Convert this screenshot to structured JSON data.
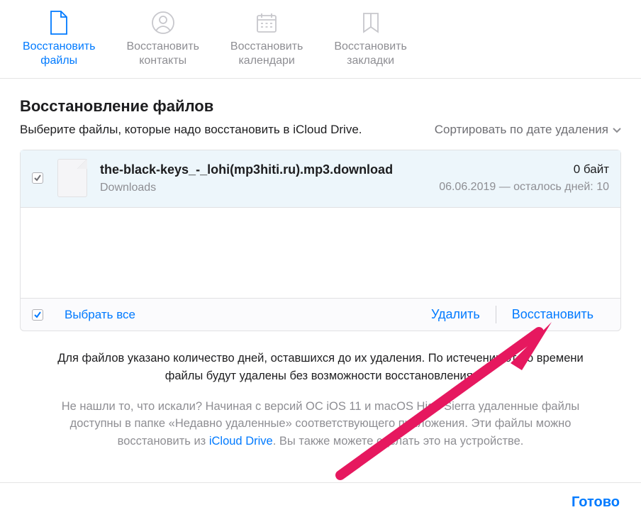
{
  "tabs": [
    {
      "label": "Восстановить\nфайлы",
      "active": true,
      "icon": "document-icon"
    },
    {
      "label": "Восстановить\nконтакты",
      "active": false,
      "icon": "person-icon"
    },
    {
      "label": "Восстановить\nкалендари",
      "active": false,
      "icon": "calendar-icon"
    },
    {
      "label": "Восстановить\nзакладки",
      "active": false,
      "icon": "bookmark-icon"
    }
  ],
  "heading": "Восстановление файлов",
  "subtitle": "Выберите файлы, которые надо восстановить в iCloud Drive.",
  "sort_label": "Сортировать по дате удаления",
  "file": {
    "name": "the-black-keys_-_lohi(mp3hiti.ru).mp3.download",
    "location": "Downloads",
    "size": "0 байт",
    "deleted_info": "06.06.2019 — осталось дней: 10",
    "checked": true
  },
  "toolbar": {
    "select_all": "Выбрать все",
    "delete": "Удалить",
    "restore": "Восстановить"
  },
  "info_primary": "Для файлов указано количество дней, оставшихся до их удаления. По истечении этого времени файлы будут удалены без возможности восстановления.",
  "info_secondary_pre": "Не нашли то, что искали? Начиная с версий ОС iOS 11 и macOS High Sierra удаленные файлы доступны в папке «Недавно удаленные» соответствующего приложения. Эти файлы можно восстановить из ",
  "info_link": "iCloud Drive",
  "info_secondary_post": ". Вы также можете сделать это на устройстве.",
  "done": "Готово",
  "colors": {
    "accent": "#007aff",
    "arrow": "#e6185f"
  }
}
